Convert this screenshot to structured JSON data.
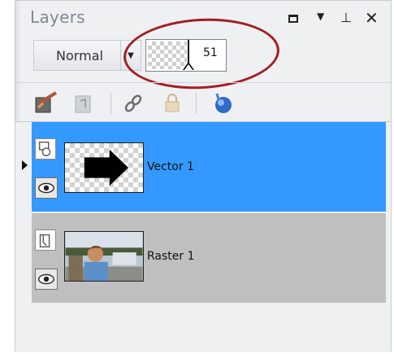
{
  "panel": {
    "title": "Layers",
    "window_controls": [
      "maximize-icon",
      "dropdown-icon",
      "pin-icon",
      "close-icon"
    ]
  },
  "blend": {
    "mode": "Normal"
  },
  "opacity": {
    "value": "51",
    "level_percent": 51
  },
  "annotation": {
    "highlight_color": "#a31e24"
  },
  "toolbar": {
    "icons": [
      "new-raster-layer-icon",
      "delete-layer-icon",
      "link-layers-icon",
      "lock-layer-icon",
      "edit-selection-icon"
    ]
  },
  "layers": [
    {
      "name": "Vector 1",
      "type": "vector",
      "selected": true,
      "visible": true,
      "thumbnail": "arrow-shape",
      "row_color": "#3399ff"
    },
    {
      "name": "Raster 1",
      "type": "raster",
      "selected": false,
      "visible": true,
      "thumbnail": "photo",
      "row_color": "#bfbfbf"
    }
  ]
}
